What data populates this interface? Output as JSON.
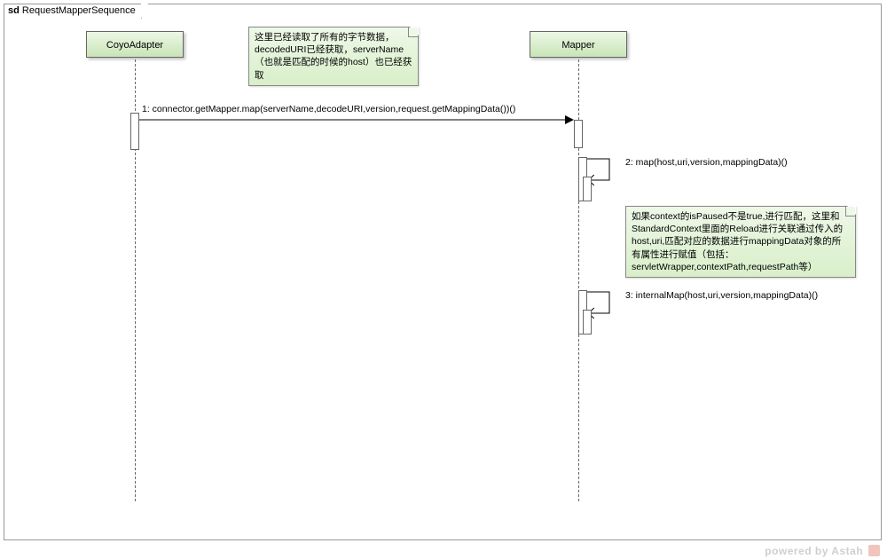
{
  "frame": {
    "prefix": "sd",
    "name": "RequestMapperSequence"
  },
  "lifelines": {
    "left": "CoyoAdapter",
    "right": "Mapper"
  },
  "notes": {
    "top": "这里已经读取了所有的字节数据，decodedURI已经获取，serverName（也就是匹配的时候的host）也已经获取",
    "right": "如果context的isPaused不是true,进行匹配，这里和StandardContext里面的Reload进行关联通过传入的host,uri,匹配对应的数据进行mappingData对象的所有属性进行赋值（包括：servletWrapper,contextPath,requestPath等）"
  },
  "messages": {
    "m1": "1: connector.getMapper.map(serverName,decodeURI,version,request.getMappingData())()",
    "m2": "2: map(host,uri,version,mappingData)()",
    "m3": "3: internalMap(host,uri,version,mappingData)()"
  },
  "footer": "powered by Astah",
  "chart_data": {
    "type": "sequence-diagram",
    "frame": "sd RequestMapperSequence",
    "participants": [
      "CoyoAdapter",
      "Mapper"
    ],
    "messages": [
      {
        "from": "CoyoAdapter",
        "to": "Mapper",
        "kind": "async",
        "label": "1: connector.getMapper.map(serverName,decodeURI,version,request.getMappingData())()"
      },
      {
        "from": "Mapper",
        "to": "Mapper",
        "kind": "self",
        "label": "2: map(host,uri,version,mappingData)()"
      },
      {
        "from": "Mapper",
        "to": "Mapper",
        "kind": "self",
        "label": "3: internalMap(host,uri,version,mappingData)()"
      }
    ],
    "notes": [
      {
        "attachedTo": "message 1 start",
        "text": "这里已经读取了所有的字节数据，decodedURI已经获取，serverName（也就是匹配的时候的host）也已经获取"
      },
      {
        "attachedTo": "between message 2 and 3",
        "text": "如果context的isPaused不是true,进行匹配，这里和StandardContext里面的Reload进行关联通过传入的host,uri,匹配对应的数据进行mappingData对象的所有属性进行赋值（包括：servletWrapper,contextPath,requestPath等）"
      }
    ]
  }
}
